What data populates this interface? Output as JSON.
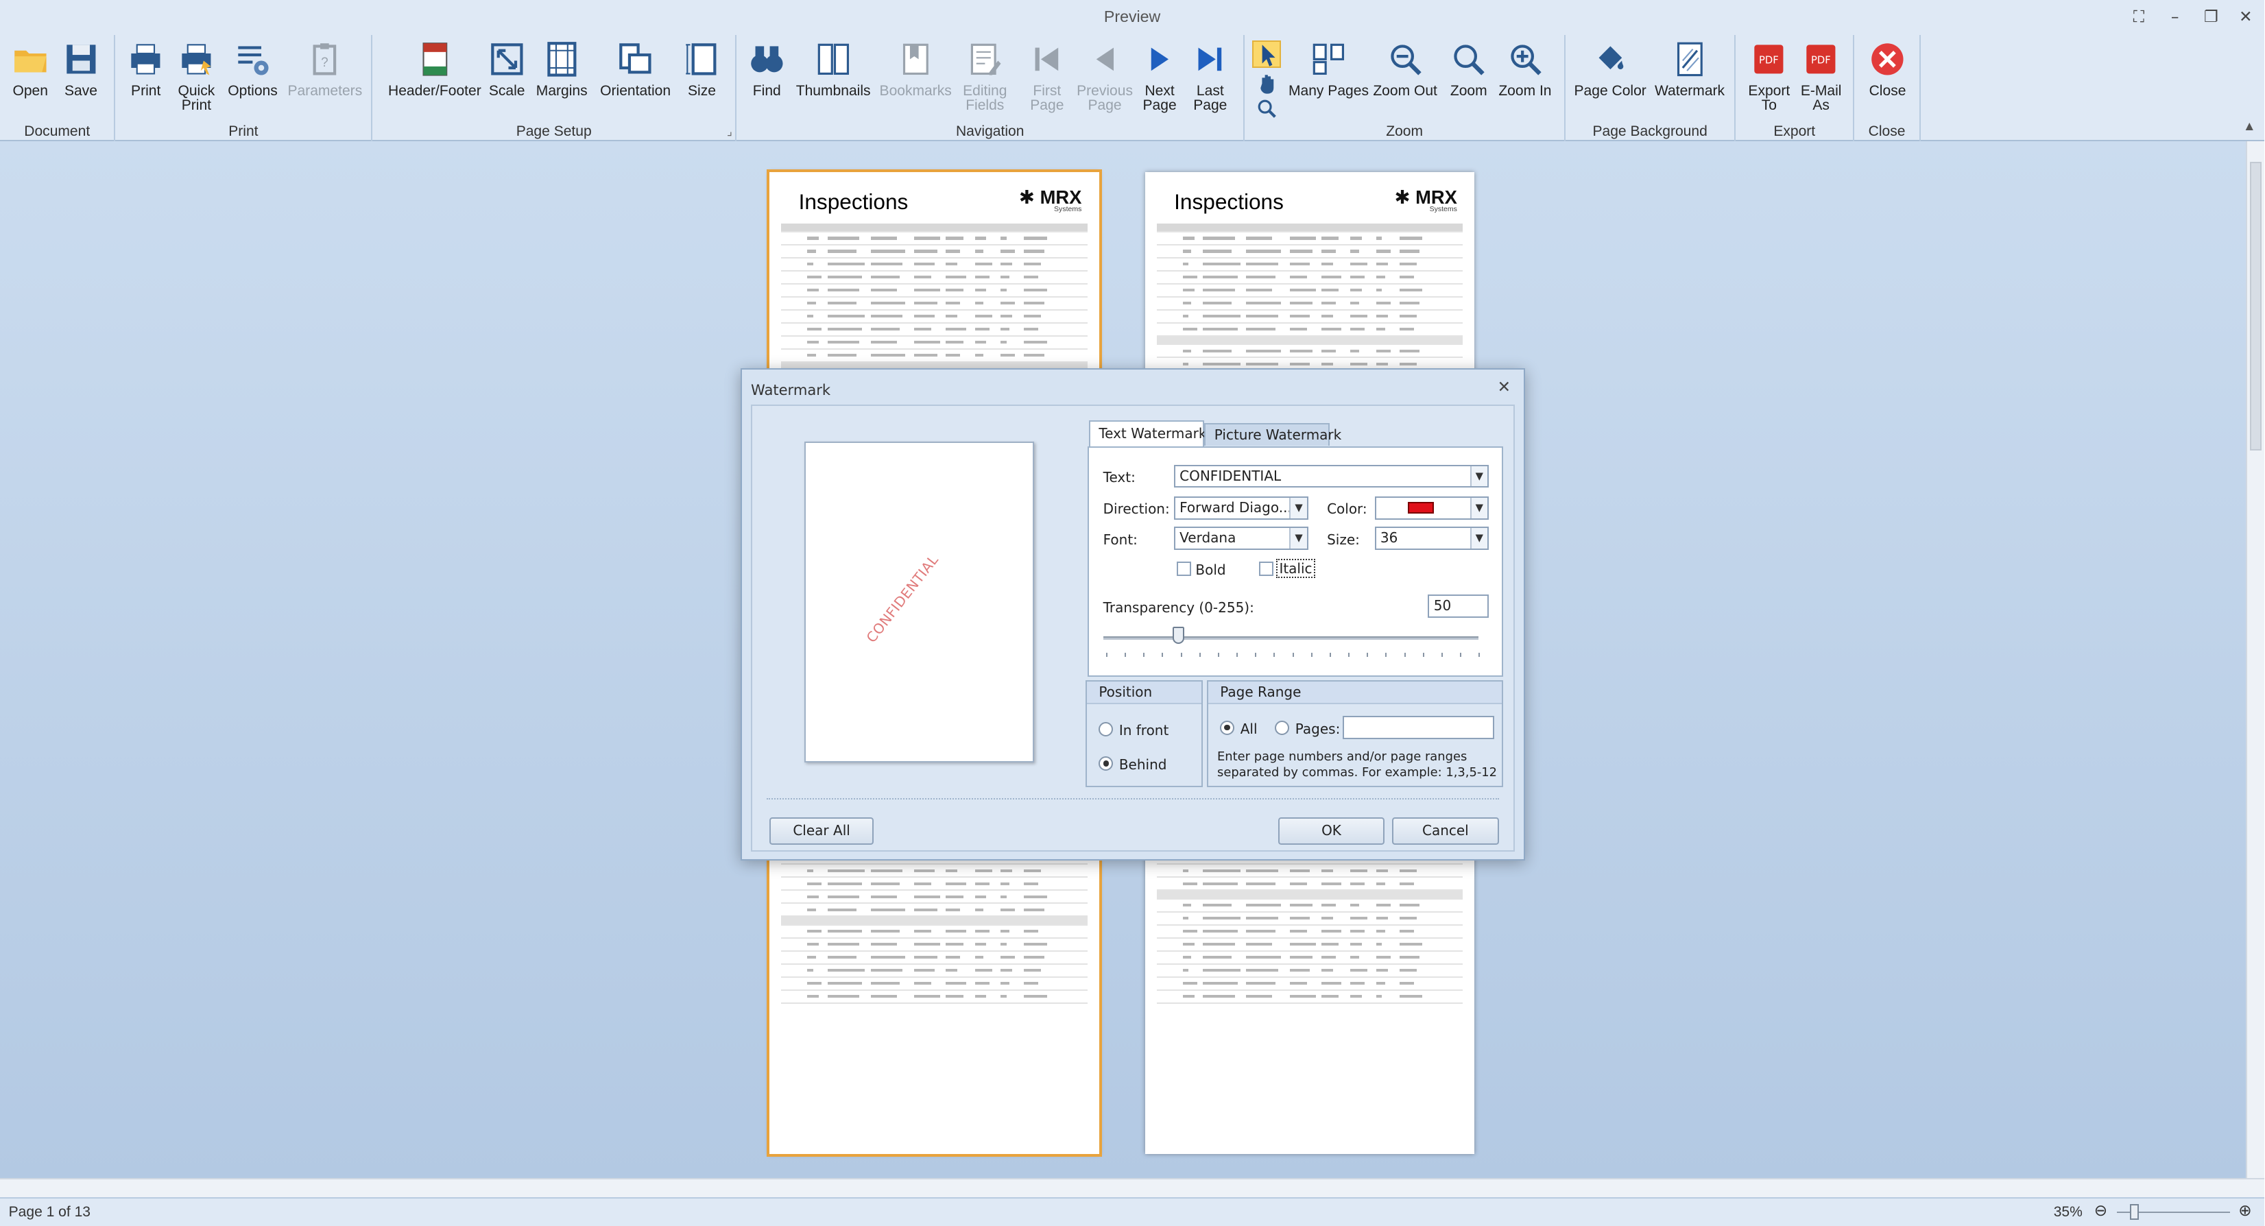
{
  "window": {
    "title": "Preview"
  },
  "ribbon": {
    "groups": {
      "document": "Document",
      "print": "Print",
      "page_setup": "Page Setup",
      "navigation": "Navigation",
      "zoom": "Zoom",
      "page_background": "Page Background",
      "export": "Export",
      "close": "Close"
    },
    "buttons": {
      "open": "Open",
      "save": "Save",
      "print": "Print",
      "quick_print_1": "Quick",
      "quick_print_2": "Print",
      "options": "Options",
      "parameters": "Parameters",
      "header_footer": "Header/Footer",
      "scale": "Scale",
      "margins": "Margins",
      "orientation": "Orientation",
      "size": "Size",
      "find": "Find",
      "thumbnails": "Thumbnails",
      "bookmarks": "Bookmarks",
      "editing_fields_1": "Editing",
      "editing_fields_2": "Fields",
      "first_page_1": "First",
      "first_page_2": "Page",
      "previous_page_1": "Previous",
      "previous_page_2": "Page",
      "next_page_1": "Next",
      "next_page_2": "Page",
      "last_page_1": "Last",
      "last_page_2": "Page",
      "many_pages": "Many Pages",
      "zoom_out": "Zoom Out",
      "zoom": "Zoom",
      "zoom_in": "Zoom In",
      "page_color": "Page Color",
      "watermark": "Watermark",
      "export_to_1": "Export",
      "export_to_2": "To",
      "email_as_1": "E-Mail",
      "email_as_2": "As",
      "close": "Close"
    }
  },
  "pages": {
    "title": "Inspections",
    "logo": "MRX",
    "logo_sub": "Systems"
  },
  "dialog": {
    "title": "Watermark",
    "preview_text": "CONFIDENTIAL",
    "tabs": {
      "text": "Text Watermark",
      "picture": "Picture Watermark"
    },
    "text_label": "Text:",
    "text_value": "CONFIDENTIAL",
    "direction_label": "Direction:",
    "direction_value": "Forward Diago...",
    "color_label": "Color:",
    "color_value": "#e0101a",
    "font_label": "Font:",
    "font_value": "Verdana",
    "size_label": "Size:",
    "size_value": "36",
    "bold_label": "Bold",
    "italic_label": "Italic",
    "transparency_label": "Transparency (0-255):",
    "transparency_value": "50",
    "position_legend": "Position",
    "in_front": "In front",
    "behind": "Behind",
    "position_selected": "Behind",
    "range_legend": "Page Range",
    "all_label": "All",
    "pages_label": "Pages:",
    "pages_value": "",
    "range_selected": "All",
    "hint_1": "Enter page numbers and/or page ranges",
    "hint_2": "separated by commas. For example: 1,3,5-12",
    "clear_all": "Clear All",
    "ok": "OK",
    "cancel": "Cancel"
  },
  "status": {
    "page_info": "Page 1 of 13",
    "zoom": "35%"
  }
}
